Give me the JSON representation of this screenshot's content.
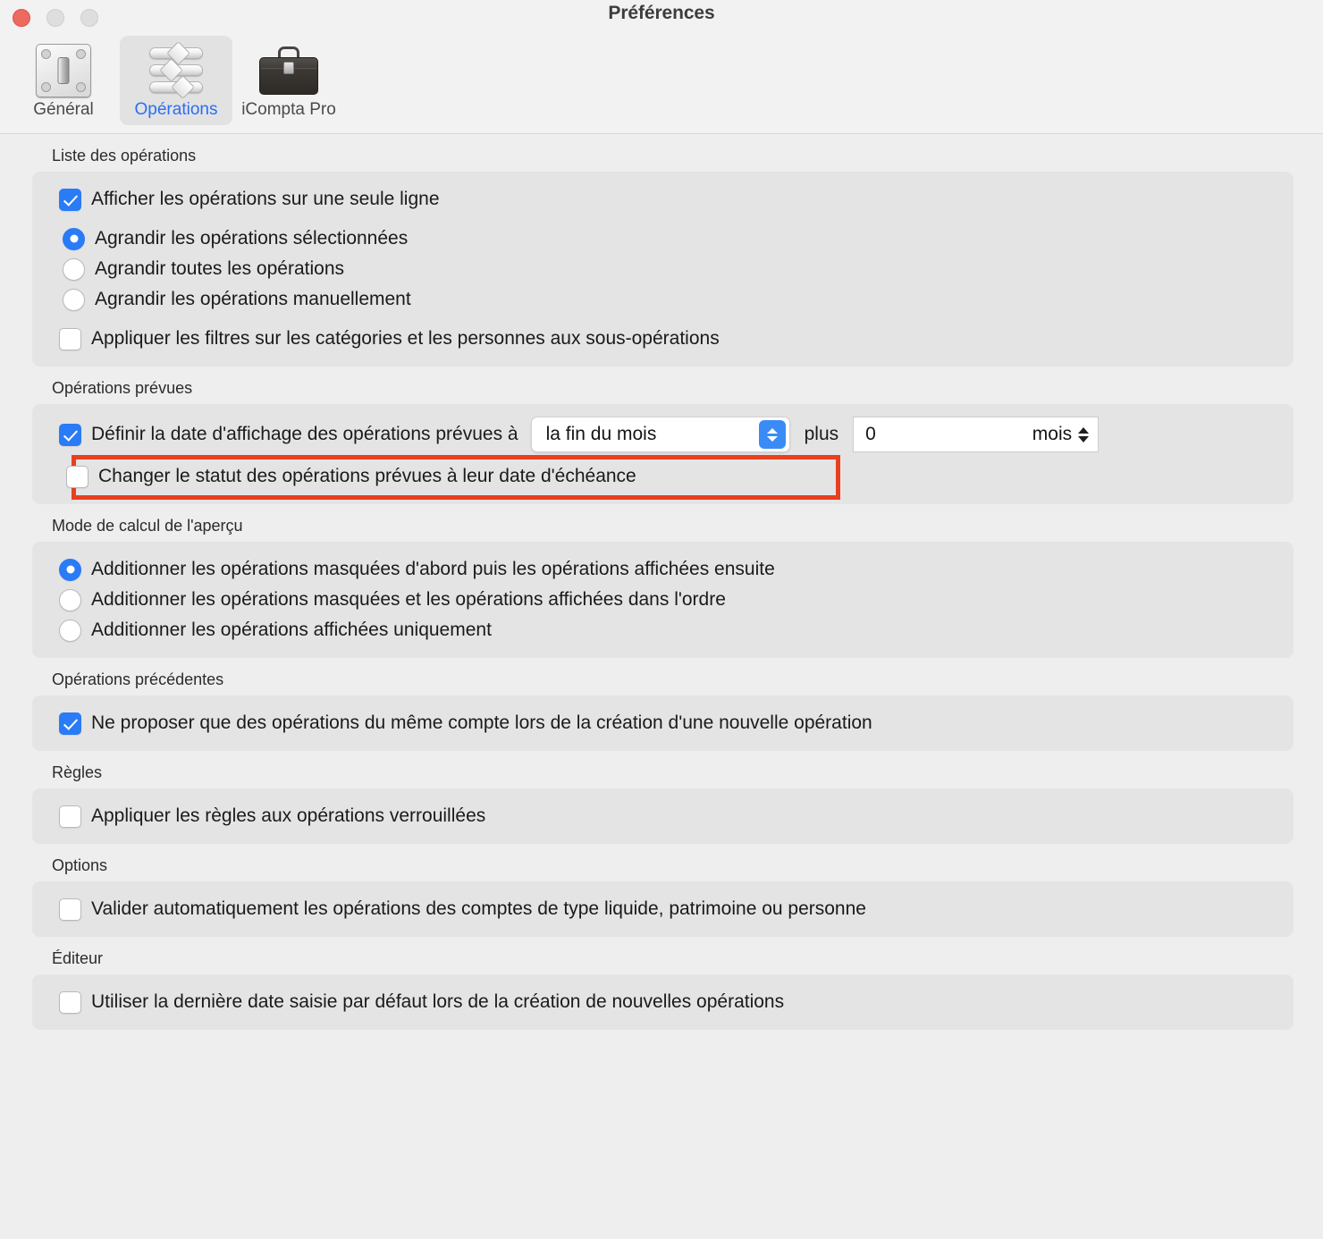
{
  "window": {
    "title": "Préférences",
    "controls": [
      {
        "name": "close-button",
        "color": "#ec6a5e"
      },
      {
        "name": "minimize-button",
        "color": "#dedede"
      },
      {
        "name": "maximize-button",
        "color": "#dedede"
      }
    ]
  },
  "toolbar": {
    "tabs": [
      {
        "label": "Général",
        "icon": "switch-plate-icon",
        "selected": false
      },
      {
        "label": "Opérations",
        "icon": "sliders-icon",
        "selected": true
      },
      {
        "label": "iCompta Pro",
        "icon": "briefcase-icon",
        "selected": false
      }
    ],
    "selected_color": "#2a6ef5"
  },
  "sections": {
    "liste": {
      "title": "Liste des opérations",
      "checkbox_single_line": {
        "label": "Afficher les opérations sur une seule ligne",
        "checked": true
      },
      "radios": [
        {
          "label": "Agrandir les opérations sélectionnées",
          "selected": true
        },
        {
          "label": "Agrandir toutes les opérations",
          "selected": false
        },
        {
          "label": "Agrandir les opérations manuellement",
          "selected": false
        }
      ],
      "checkbox_filters": {
        "label": "Appliquer les filtres sur les catégories et les personnes aux sous-opérations",
        "checked": false
      }
    },
    "prevues": {
      "title": "Opérations prévues",
      "checkbox_date": {
        "label": "Définir la date d'affichage des opérations prévues à",
        "checked": true
      },
      "popup": {
        "value": "la fin du mois",
        "accent": "#3b8bf7"
      },
      "plus_label": "plus",
      "stepper": {
        "value": "0",
        "unit": "mois"
      },
      "checkbox_statut": {
        "label": "Changer le statut des opérations prévues à leur date d'échéance",
        "checked": false
      },
      "highlight_color": "#e8401f"
    },
    "apercu": {
      "title": "Mode de calcul de l'aperçu",
      "radios": [
        {
          "label": "Additionner les opérations masquées d'abord puis les opérations affichées ensuite",
          "selected": true
        },
        {
          "label": "Additionner les opérations masquées et les opérations affichées dans l'ordre",
          "selected": false
        },
        {
          "label": "Additionner les opérations affichées uniquement",
          "selected": false
        }
      ]
    },
    "precedentes": {
      "title": "Opérations précédentes",
      "checkbox": {
        "label": "Ne proposer que des opérations du même compte lors de la création d'une nouvelle opération",
        "checked": true
      }
    },
    "regles": {
      "title": "Règles",
      "checkbox": {
        "label": "Appliquer les règles aux opérations verrouillées",
        "checked": false
      }
    },
    "options": {
      "title": "Options",
      "checkbox": {
        "label": "Valider automatiquement les opérations des comptes de type liquide, patrimoine ou personne",
        "checked": false
      }
    },
    "editeur": {
      "title": "Éditeur",
      "checkbox": {
        "label": "Utiliser la dernière date saisie par défaut lors de la création de nouvelles opérations",
        "checked": false
      }
    }
  }
}
